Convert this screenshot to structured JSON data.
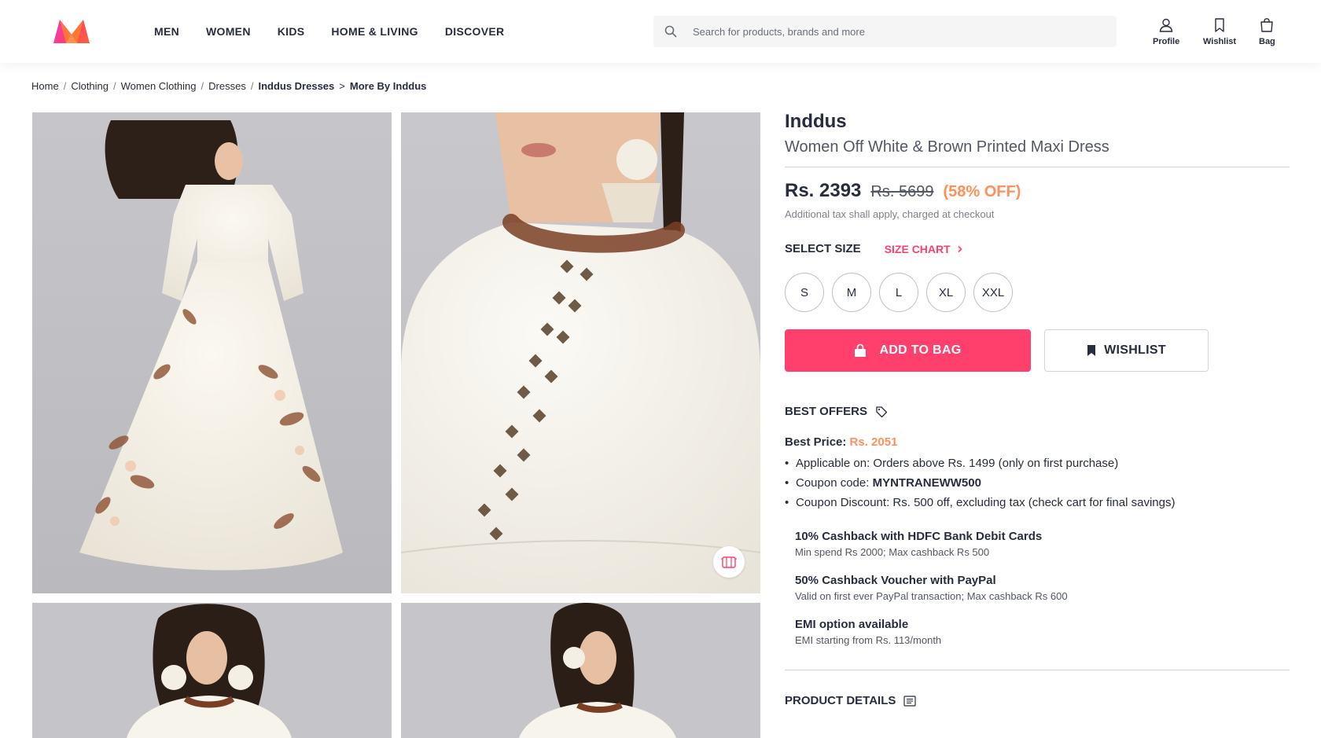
{
  "nav": {
    "items": [
      {
        "label": "MEN"
      },
      {
        "label": "WOMEN"
      },
      {
        "label": "KIDS"
      },
      {
        "label": "HOME & LIVING"
      },
      {
        "label": "DISCOVER"
      }
    ]
  },
  "search": {
    "placeholder": "Search for products, brands and more"
  },
  "actions": {
    "profile": "Profile",
    "wishlist": "Wishlist",
    "bag": "Bag"
  },
  "breadcrumb": [
    {
      "label": "Home"
    },
    {
      "label": "Clothing"
    },
    {
      "label": "Women Clothing"
    },
    {
      "label": "Dresses"
    },
    {
      "label": "Inddus Dresses"
    },
    {
      "label": "More By Inddus"
    }
  ],
  "product": {
    "brand": "Inddus",
    "name": "Women Off White & Brown Printed Maxi Dress",
    "price": "Rs. 2393",
    "mrp": "Rs. 5699",
    "discount": "(58% OFF)",
    "tax_note": "Additional tax shall apply, charged at checkout"
  },
  "size": {
    "title": "SELECT SIZE",
    "chart_label": "SIZE CHART",
    "options": [
      "S",
      "M",
      "L",
      "XL",
      "XXL"
    ]
  },
  "buttons": {
    "add_to_bag": "ADD TO BAG",
    "wishlist": "WISHLIST"
  },
  "offers": {
    "title": "BEST OFFERS",
    "best_price_label": "Best Price:",
    "best_price_value": "Rs. 2051",
    "bullets": {
      "applicable": "Applicable on: Orders above Rs. 1499 (only on first purchase)",
      "coupon_label": "Coupon code: ",
      "coupon_code": "MYNTRANEWW500",
      "discount": "Coupon Discount: Rs. 500 off, excluding tax (check cart for final savings)"
    },
    "items": [
      {
        "title": "10% Cashback with HDFC Bank Debit Cards",
        "sub": "Min spend Rs 2000; Max cashback Rs 500"
      },
      {
        "title": "50% Cashback Voucher with PayPal",
        "sub": "Valid on first ever PayPal transaction; Max cashback Rs 600"
      },
      {
        "title": "EMI option available",
        "sub": "EMI starting from Rs. 113/month"
      }
    ]
  },
  "product_details": {
    "title": "PRODUCT DETAILS"
  },
  "colors": {
    "accent": "#ff3f6c",
    "discount": "#ff905a",
    "text": "#282c3f"
  }
}
